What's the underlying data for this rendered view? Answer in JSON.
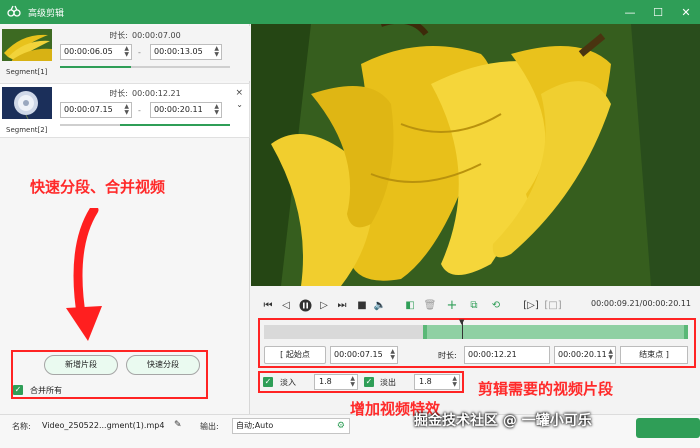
{
  "window": {
    "title": "高级剪辑"
  },
  "segments": [
    {
      "label": "Segment[1]",
      "duration_label": "时长:",
      "duration": "00:00:07.00",
      "start": "00:00:06.05",
      "end": "00:00:13.05",
      "fill_start": 0.0,
      "fill_end": 0.42
    },
    {
      "label": "Segment[2]",
      "duration_label": "时长:",
      "duration": "00:00:12.21",
      "start": "00:00:07.15",
      "end": "00:00:20.11",
      "fill_start": 0.35,
      "fill_end": 1.0
    }
  ],
  "segment_close": "×",
  "segment_collapse": "⌄",
  "dash": "-",
  "annotations": {
    "split_merge": "快速分段、合并视频",
    "clip_segments": "剪辑需要的视频片段",
    "effects": "增加视频特效"
  },
  "buttons": {
    "add_segment": "新增片段",
    "quick_split": "快速分段"
  },
  "merge_all": {
    "label": "合并所有",
    "checked": true
  },
  "player": {
    "time": "00:00:09.21/00:00:20.11"
  },
  "trim": {
    "start_btn": "[ 起始点",
    "start_value": "00:00:07.15",
    "duration_label": "时长:",
    "duration_value": "00:00:12.21",
    "end_value": "00:00:20.11",
    "end_btn": "结束点 ]",
    "selection_start": 0.375,
    "selection_end": 1.0,
    "playhead": 0.47
  },
  "fade": {
    "in_label": "淡入",
    "in_value": "1.8",
    "out_label": "淡出",
    "out_value": "1.8"
  },
  "bottom": {
    "name_label": "名称:",
    "name_value": "Video_250522...gment(1).mp4",
    "output_label": "输出:",
    "output_value": "自动;Auto"
  },
  "watermark": "掘金技术社区 @ 一罐小可乐",
  "colors": {
    "accent": "#2f9e57",
    "annotation": "#ff2a2a"
  }
}
